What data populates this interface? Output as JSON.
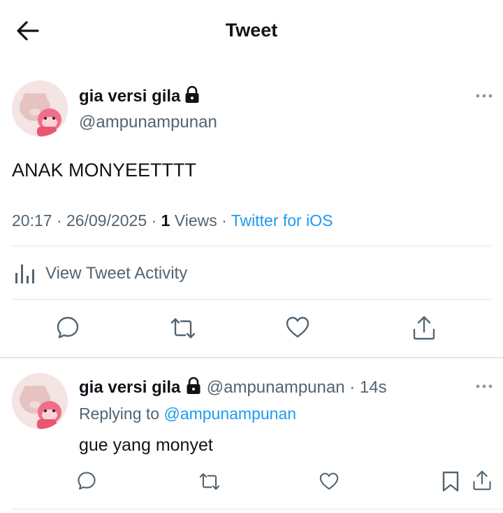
{
  "header": {
    "title": "Tweet"
  },
  "tweet": {
    "author_name": "gia versi gila",
    "author_handle": "@ampunampunan",
    "text": "ANAK MONYEETTTT",
    "time": "20:17",
    "date": "26/09/2025",
    "views_count": "1",
    "views_label": "Views",
    "source": "Twitter for iOS",
    "activity_label": "View Tweet Activity"
  },
  "reply": {
    "author_name": "gia versi gila",
    "author_handle": "@ampunampunan",
    "age": "14s",
    "replying_to_label": "Replying to",
    "replying_to_handle": "@ampunampunan",
    "text": "gue yang monyet"
  },
  "icons": {
    "back": "arrow-left-icon",
    "lock": "lock-icon",
    "more": "ellipsis-icon",
    "activity": "bar-chart-icon",
    "reply": "speech-bubble-icon",
    "retweet": "retweet-icon",
    "like": "heart-icon",
    "share": "share-icon",
    "bookmark": "bookmark-icon"
  },
  "colors": {
    "text": "#0f1419",
    "secondary": "#536471",
    "accent": "#1d9bf0",
    "divider": "#e1e5e8"
  }
}
